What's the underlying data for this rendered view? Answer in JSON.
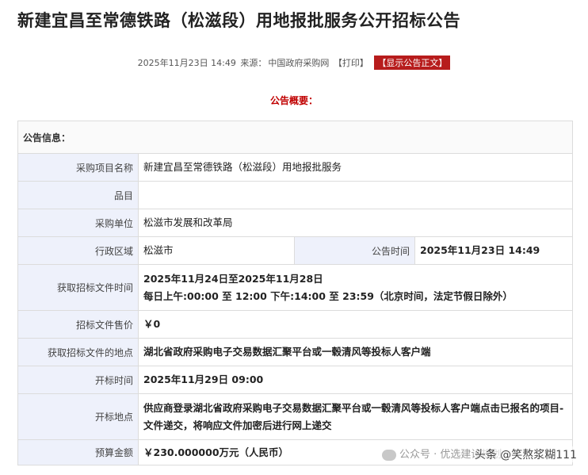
{
  "page": {
    "title": "新建宜昌至常德铁路（松滋段）用地报批服务公开招标公告",
    "meta": {
      "date": "2025年11月23日 14:49",
      "source_label": "来源：",
      "source": "中国政府采购网",
      "print": "【打印】",
      "show_content": "【显示公告正文】"
    },
    "overview_title": "公告概要："
  },
  "table": {
    "section_header": "公告信息：",
    "rows": {
      "project_name": {
        "label": "采购项目名称",
        "value": "新建宜昌至常德铁路（松滋段）用地报批服务"
      },
      "item": {
        "label": "品目",
        "value": ""
      },
      "purchaser": {
        "label": "采购单位",
        "value": "松滋市发展和改革局"
      },
      "region": {
        "label": "行政区域",
        "value": "松滋市",
        "time_label": "公告时间",
        "time_value": "2025年11月23日 14:49"
      },
      "obtain_time": {
        "label": "获取招标文件时间",
        "line1": "2025年11月24日至2025年11月28日",
        "line2": "每日上午:00:00 至 12:00  下午:14:00 至 23:59（北京时间，法定节假日除外）"
      },
      "price": {
        "label": "招标文件售价",
        "value": "￥0"
      },
      "obtain_place": {
        "label": "获取招标文件的地点",
        "value": "湖北省政府采购电子交易数据汇聚平台或一毂清风等投标人客户端"
      },
      "open_time": {
        "label": "开标时间",
        "value": "2025年11月29日 09:00"
      },
      "open_place": {
        "label": "开标地点",
        "value": "供应商登录湖北省政府采购电子交易数据汇聚平台或一毂清风等投标人客户端点击已报名的项目-文件递交，将响应文件加密后进行网上递交"
      },
      "budget": {
        "label": "预算金额",
        "value": "￥230.000000万元（人民币）"
      }
    }
  },
  "watermark": {
    "left": "公众号 · 优选建设规划",
    "right": "头条 @笑熬浆糊111"
  }
}
